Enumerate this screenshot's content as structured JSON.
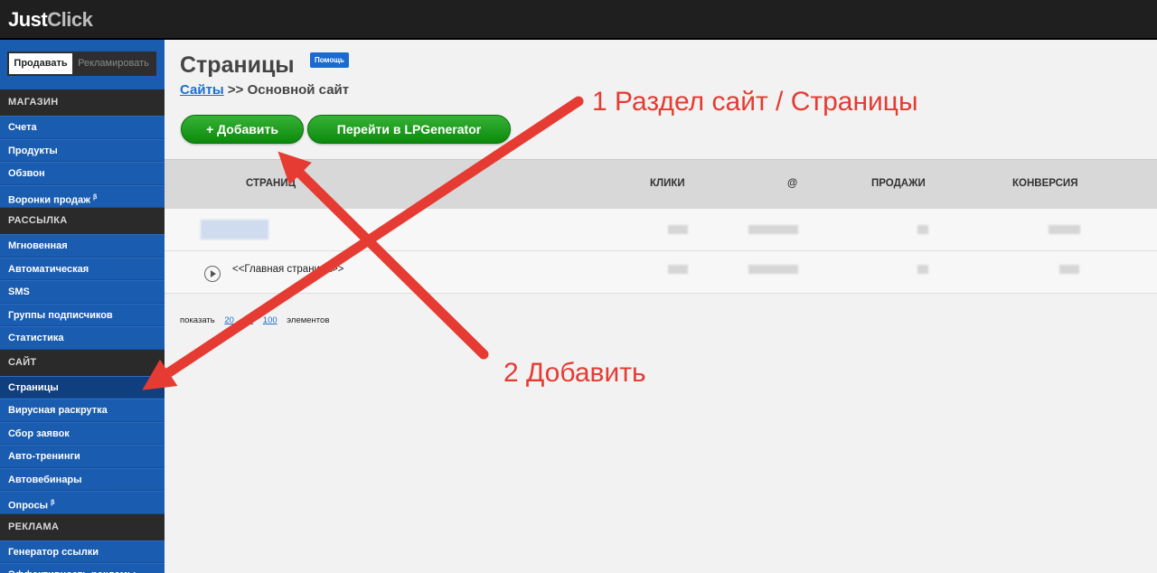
{
  "app": {
    "logo_a": "Just",
    "logo_b": "Click"
  },
  "sidebar": {
    "mode_on": "Продавать",
    "mode_off": "Рекламировать",
    "sections": [
      {
        "title": "МАГАЗИН",
        "items": [
          "Счета",
          "Продукты",
          "Обзвон",
          "Воронки продаж"
        ]
      },
      {
        "title": "РАССЫЛКА",
        "items": [
          "Мгновенная",
          "Автоматическая",
          "SMS",
          "Группы подписчиков",
          "Статистика"
        ]
      },
      {
        "title": "САЙТ",
        "items": [
          "Страницы",
          "Вирусная раскрутка",
          "Сбор заявок",
          "Авто-тренинги",
          "Автовебинары",
          "Опросы"
        ]
      },
      {
        "title": "РЕКЛАМА",
        "items": [
          "Генератор ссылки",
          "Эффективность рекламы"
        ]
      }
    ],
    "beta": "β"
  },
  "main": {
    "title": "Страницы",
    "help": "Помощь",
    "crumb_link": "Сайты",
    "crumb_rest": ">> Основной сайт",
    "add_button": "+ Добавить",
    "lp_button": "Перейти в LPGenerator",
    "columns": [
      "СТРАНИЦ",
      "КЛИКИ",
      "@",
      "ПРОДАЖИ",
      "КОНВЕРСИЯ"
    ],
    "page_name": "<<Главная страница>>",
    "pager_prefix": "показать",
    "pager_options": [
      "20",
      "50",
      "100"
    ],
    "pager_suffix": "элементов"
  },
  "annotations": {
    "a1": "1 Раздел сайт / Страницы",
    "a2": "2 Добавить"
  },
  "colors": {
    "accent": "#1a5cb0",
    "button": "#1a9a1a",
    "annotation": "#e53b32"
  }
}
